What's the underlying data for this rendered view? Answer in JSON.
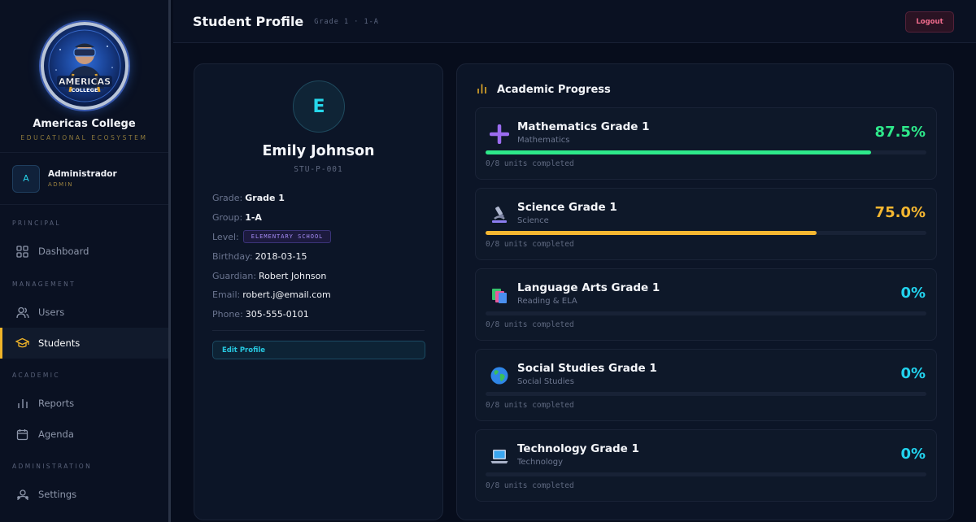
{
  "sidebar": {
    "brand_name": "Americas College",
    "brand_subtitle": "EDUCATIONAL ECOSYSTEM",
    "logo_text_top": "AMERICAS",
    "logo_text_bottom": "COLLEGE",
    "user": {
      "initial": "A",
      "name": "Administrador",
      "role": "ADMIN"
    },
    "sections": {
      "principal": "PRINCIPAL",
      "management": "MANAGEMENT",
      "academic": "ACADEMIC",
      "administration": "ADMINISTRATION"
    },
    "items": {
      "dashboard": {
        "label": "Dashboard",
        "icon": "grid-icon"
      },
      "users": {
        "label": "Users",
        "icon": "users-icon"
      },
      "students": {
        "label": "Students",
        "icon": "graduation-cap-icon",
        "active": true
      },
      "reports": {
        "label": "Reports",
        "icon": "bar-chart-icon"
      },
      "agenda": {
        "label": "Agenda",
        "icon": "calendar-icon"
      },
      "settings": {
        "label": "Settings",
        "icon": "settings-icon"
      }
    }
  },
  "header": {
    "title": "Student Profile",
    "subtitle": "Grade 1 · 1-A",
    "logout_label": "Logout"
  },
  "profile": {
    "initial": "E",
    "name": "Emily Johnson",
    "student_id": "STU-P-001",
    "fields": {
      "grade": {
        "label": "Grade:",
        "value": "Grade 1"
      },
      "group": {
        "label": "Group:",
        "value": "1-A"
      },
      "level": {
        "label": "Level:",
        "value": "ELEMENTARY SCHOOL"
      },
      "birthday": {
        "label": "Birthday:",
        "value": "2018-03-15"
      },
      "guardian": {
        "label": "Guardian:",
        "value": "Robert Johnson"
      },
      "email": {
        "label": "Email:",
        "value": "robert.j@email.com"
      },
      "phone": {
        "label": "Phone:",
        "value": "305-555-0101"
      }
    },
    "edit_label": "Edit Profile"
  },
  "progress": {
    "title": "Academic Progress",
    "subjects": [
      {
        "name": "Mathematics Grade 1",
        "category": "Mathematics",
        "percent_label": "87.5%",
        "progress": 0.875,
        "color": "#2ee88a",
        "units": "0/8 units completed",
        "icon": "plus-icon"
      },
      {
        "name": "Science Grade 1",
        "category": "Science",
        "percent_label": "75.0%",
        "progress": 0.75,
        "color": "#f5b731",
        "units": "0/8 units completed",
        "icon": "microscope-icon"
      },
      {
        "name": "Language Arts Grade 1",
        "category": "Reading & ELA",
        "percent_label": "0%",
        "progress": 0,
        "color": "#22d3ee",
        "units": "0/8 units completed",
        "icon": "books-icon"
      },
      {
        "name": "Social Studies Grade 1",
        "category": "Social Studies",
        "percent_label": "0%",
        "progress": 0,
        "color": "#22d3ee",
        "units": "0/8 units completed",
        "icon": "globe-icon"
      },
      {
        "name": "Technology Grade 1",
        "category": "Technology",
        "percent_label": "0%",
        "progress": 0,
        "color": "#22d3ee",
        "units": "0/8 units completed",
        "icon": "laptop-icon"
      }
    ]
  }
}
